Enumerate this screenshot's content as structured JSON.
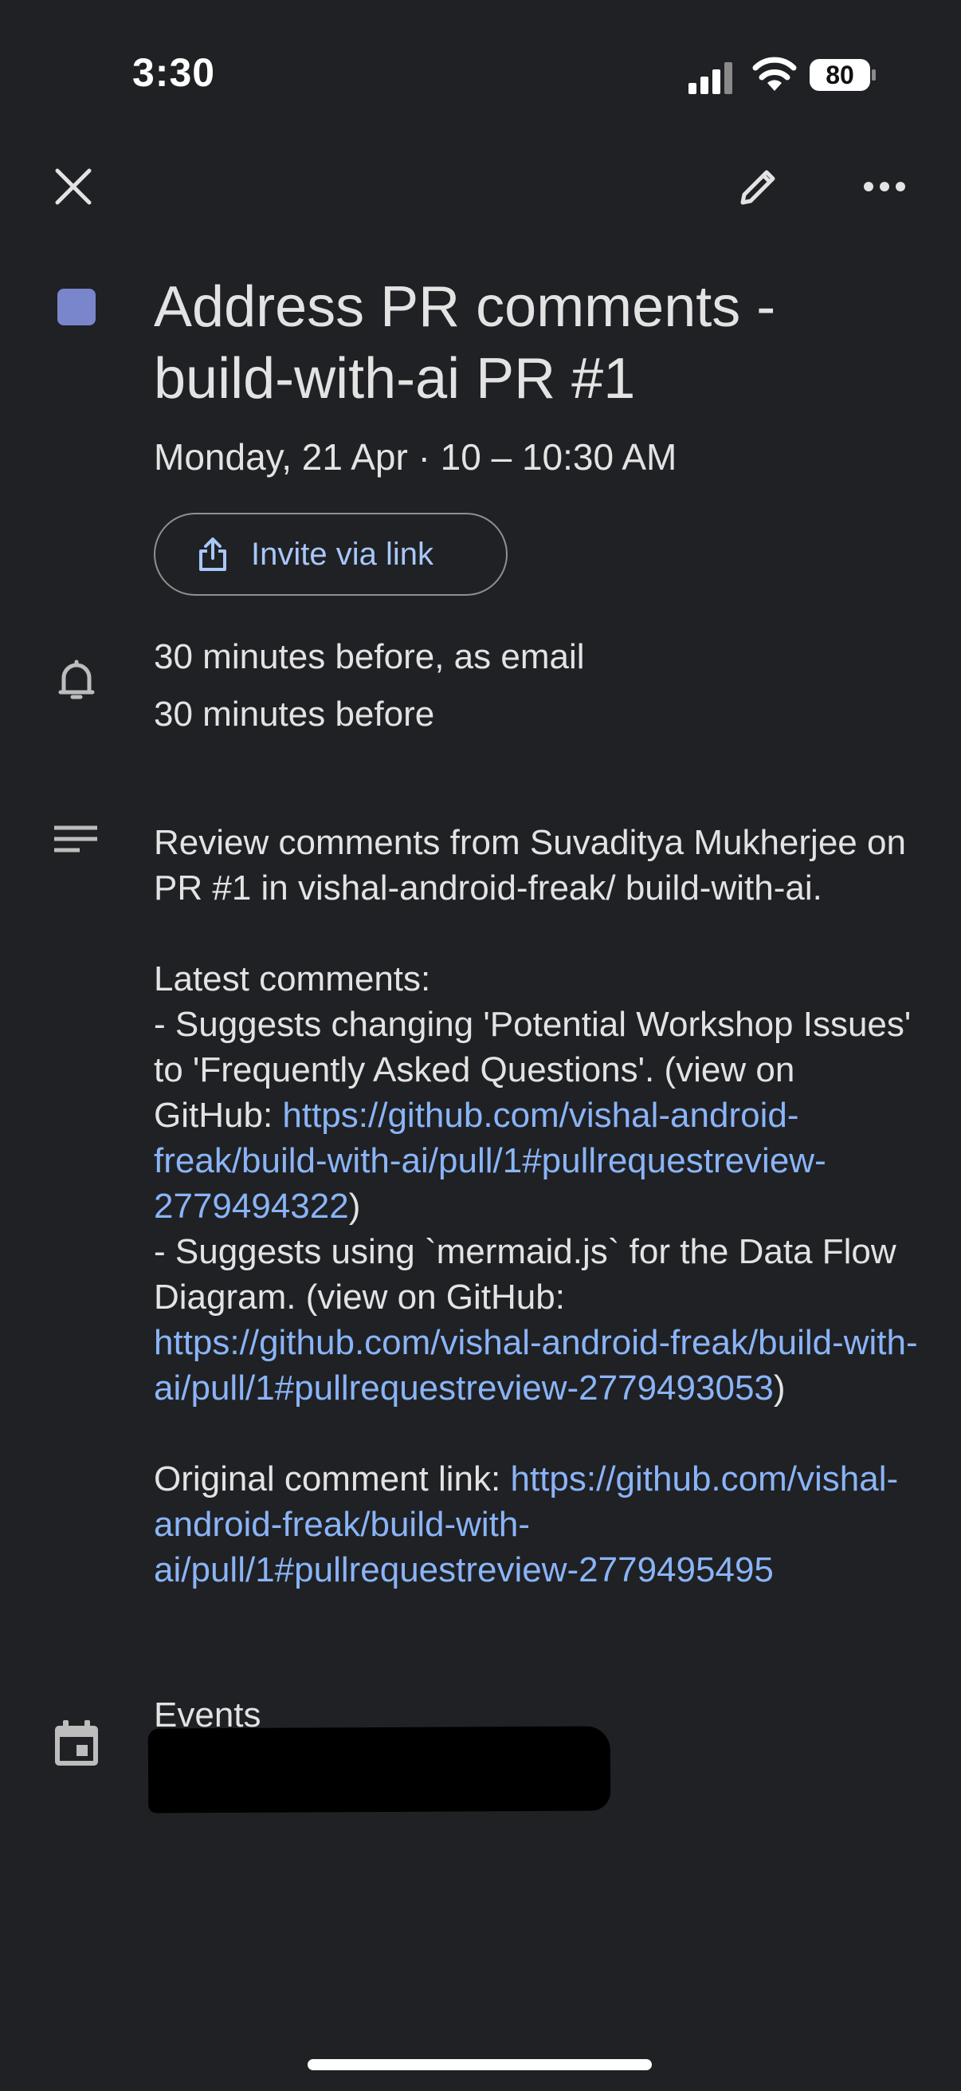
{
  "status_bar": {
    "time": "3:30",
    "battery_level": "80"
  },
  "event": {
    "color": "#7986cb",
    "title": "Address PR comments - build-with-ai PR #1",
    "datetime": "Monday, 21 Apr · 10 – 10:30 AM",
    "invite_label": "Invite via link",
    "reminders": [
      "30 minutes before, as email",
      "30 minutes before"
    ],
    "description": {
      "intro": "Review comments from Suvaditya Mukherjee on PR #1 in vishal-android-freak/ build-with-ai.",
      "latest_heading": "Latest comments:",
      "comment1_text": "- Suggests changing 'Potential Workshop Issues' to 'Frequently Asked Questions'. (view on GitHub: ",
      "comment1_link": "https://github.com/vishal-android-freak/build-with-ai/pull/1#pullrequestreview-2779494322",
      "comment2_text": "- Suggests using `mermaid.js` for the Data Flow Diagram. (view on GitHub: ",
      "comment2_link": "https://github.com/vishal-android-freak/build-with-ai/pull/1#pullrequestreview-2779493053",
      "close_paren": ")",
      "original_label": "Original comment link: ",
      "original_link": "https://github.com/vishal-android-freak/build-with-ai/pull/1#pullrequestreview-2779495495"
    },
    "calendar_label": "Events"
  },
  "colors": {
    "background": "#202124",
    "link": "#8ab4f8",
    "accent": "#a8c7fa"
  },
  "icons": [
    "signal-icon",
    "wifi-icon",
    "battery-icon",
    "close-icon",
    "edit-pencil-icon",
    "more-horizontal-icon",
    "share-icon",
    "bell-icon",
    "notes-icon",
    "calendar-icon"
  ]
}
